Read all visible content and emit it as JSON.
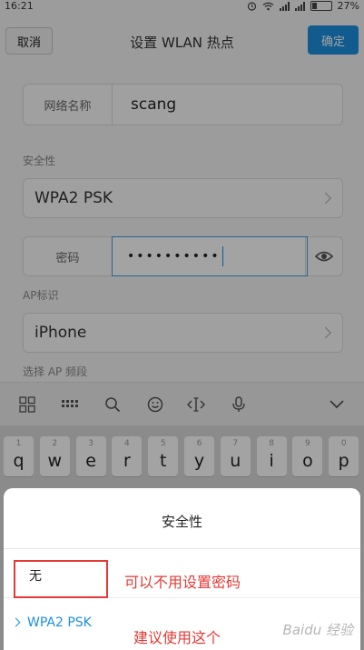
{
  "status_bar": {
    "time": "16:21",
    "battery": "27%",
    "battery_level": 0.27
  },
  "header": {
    "cancel_label": "取消",
    "title": "设置 WLAN 热点",
    "confirm_label": "确定"
  },
  "form": {
    "network_name_label": "网络名称",
    "network_name_value": "scang",
    "security_section": "安全性",
    "security_value": "WPA2 PSK",
    "password_label": "密码",
    "password_value": "••••••••••",
    "ap_section": "AP标识",
    "ap_value": "iPhone",
    "band_section": "选择 AP 频段"
  },
  "keyboard": {
    "keys": [
      {
        "num": "1",
        "ch": "q"
      },
      {
        "num": "2",
        "ch": "w"
      },
      {
        "num": "3",
        "ch": "e"
      },
      {
        "num": "4",
        "ch": "r"
      },
      {
        "num": "5",
        "ch": "t"
      },
      {
        "num": "6",
        "ch": "y"
      },
      {
        "num": "7",
        "ch": "u"
      },
      {
        "num": "8",
        "ch": "i"
      },
      {
        "num": "9",
        "ch": "o"
      },
      {
        "num": "0",
        "ch": "p"
      }
    ]
  },
  "sheet": {
    "title": "安全性",
    "options": [
      {
        "label": "无"
      },
      {
        "label": "WPA2 PSK"
      }
    ]
  },
  "annotations": {
    "note_none": "可以不用设置密码",
    "note_wpa2": "建议使用这个"
  },
  "watermark": "Baidu 经验",
  "colors": {
    "accent": "#1d8fe0",
    "annotation": "#e53935"
  }
}
